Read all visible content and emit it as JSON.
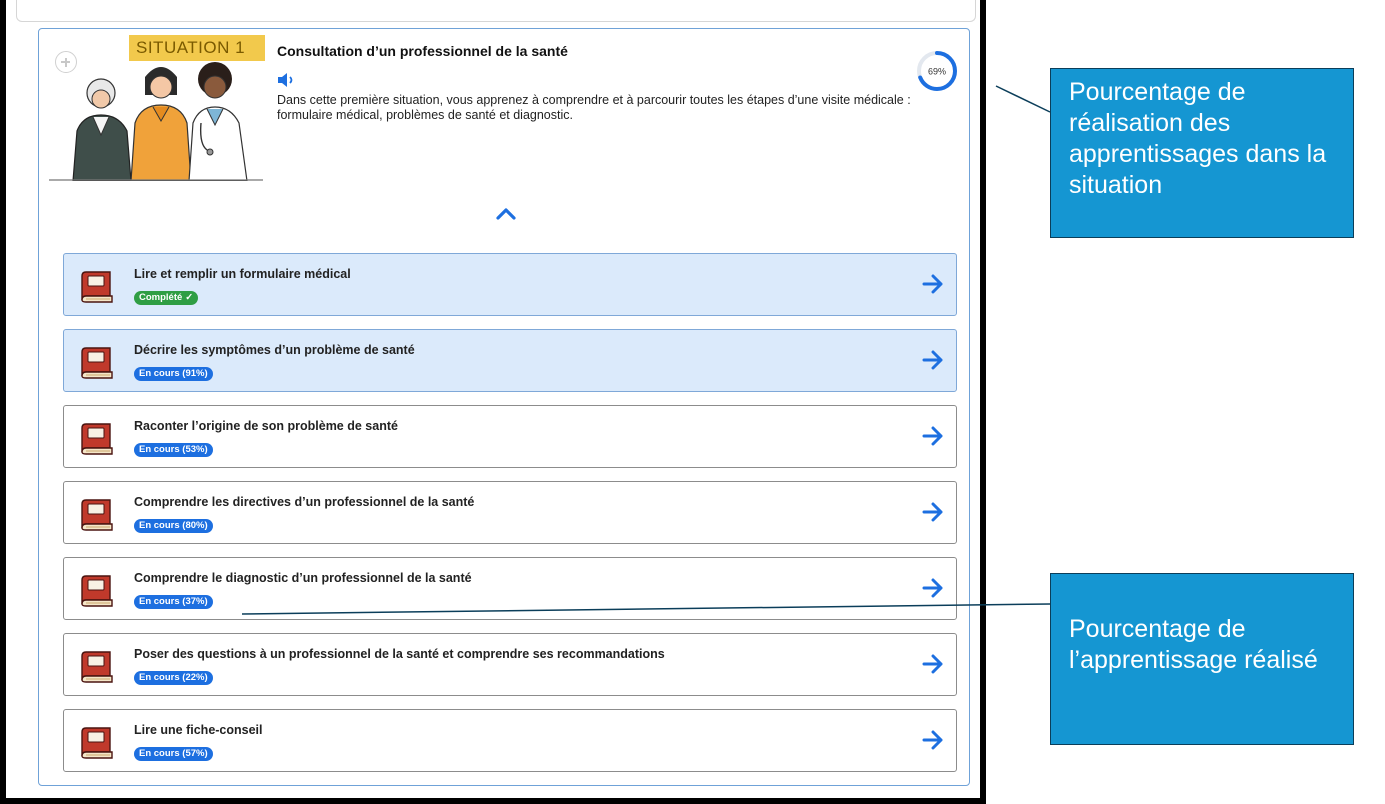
{
  "situation": {
    "tag": "SITUATION 1",
    "title": "Consultation d’un professionnel de la santé",
    "description": "Dans cette première situation, vous apprenez à comprendre et à parcourir toutes les étapes d’une visite médicale : formulaire médical, problèmes de santé et diagnostic.",
    "progress_label": "69%",
    "progress_value": 0.69,
    "icons": [
      "plus-icon",
      "speaker-icon",
      "chevron-up-icon"
    ]
  },
  "items": [
    {
      "title": "Lire et remplir un formulaire médical",
      "badge": "Complété",
      "status": "complete",
      "check": "✓"
    },
    {
      "title": "Décrire les symptômes d’un problème de santé",
      "badge": "En cours (91%)",
      "status": "progress"
    },
    {
      "title": "Raconter l’origine de son problème de santé",
      "badge": "En cours (53%)",
      "status": "progress"
    },
    {
      "title": "Comprendre les directives d’un professionnel de la santé",
      "badge": "En cours (80%)",
      "status": "progress"
    },
    {
      "title": "Comprendre le diagnostic d’un professionnel de la santé",
      "badge": "En cours (37%)",
      "status": "progress"
    },
    {
      "title": "Poser des questions à un professionnel de la santé et comprendre ses recommandations",
      "badge": "En cours (22%)",
      "status": "progress"
    },
    {
      "title": "Lire une fiche-conseil",
      "badge": "En cours (57%)",
      "status": "progress"
    }
  ],
  "annotations": {
    "top": "Pourcentage de réalisation des apprentissages dans la situation",
    "bottom": "Pourcentage de l’apprentissage réalisé"
  },
  "colors": {
    "accent_blue": "#1d6fe0",
    "complete_green": "#2f9e44",
    "tag_yellow": "#f2c94c",
    "callout_blue": "#1596d2"
  }
}
